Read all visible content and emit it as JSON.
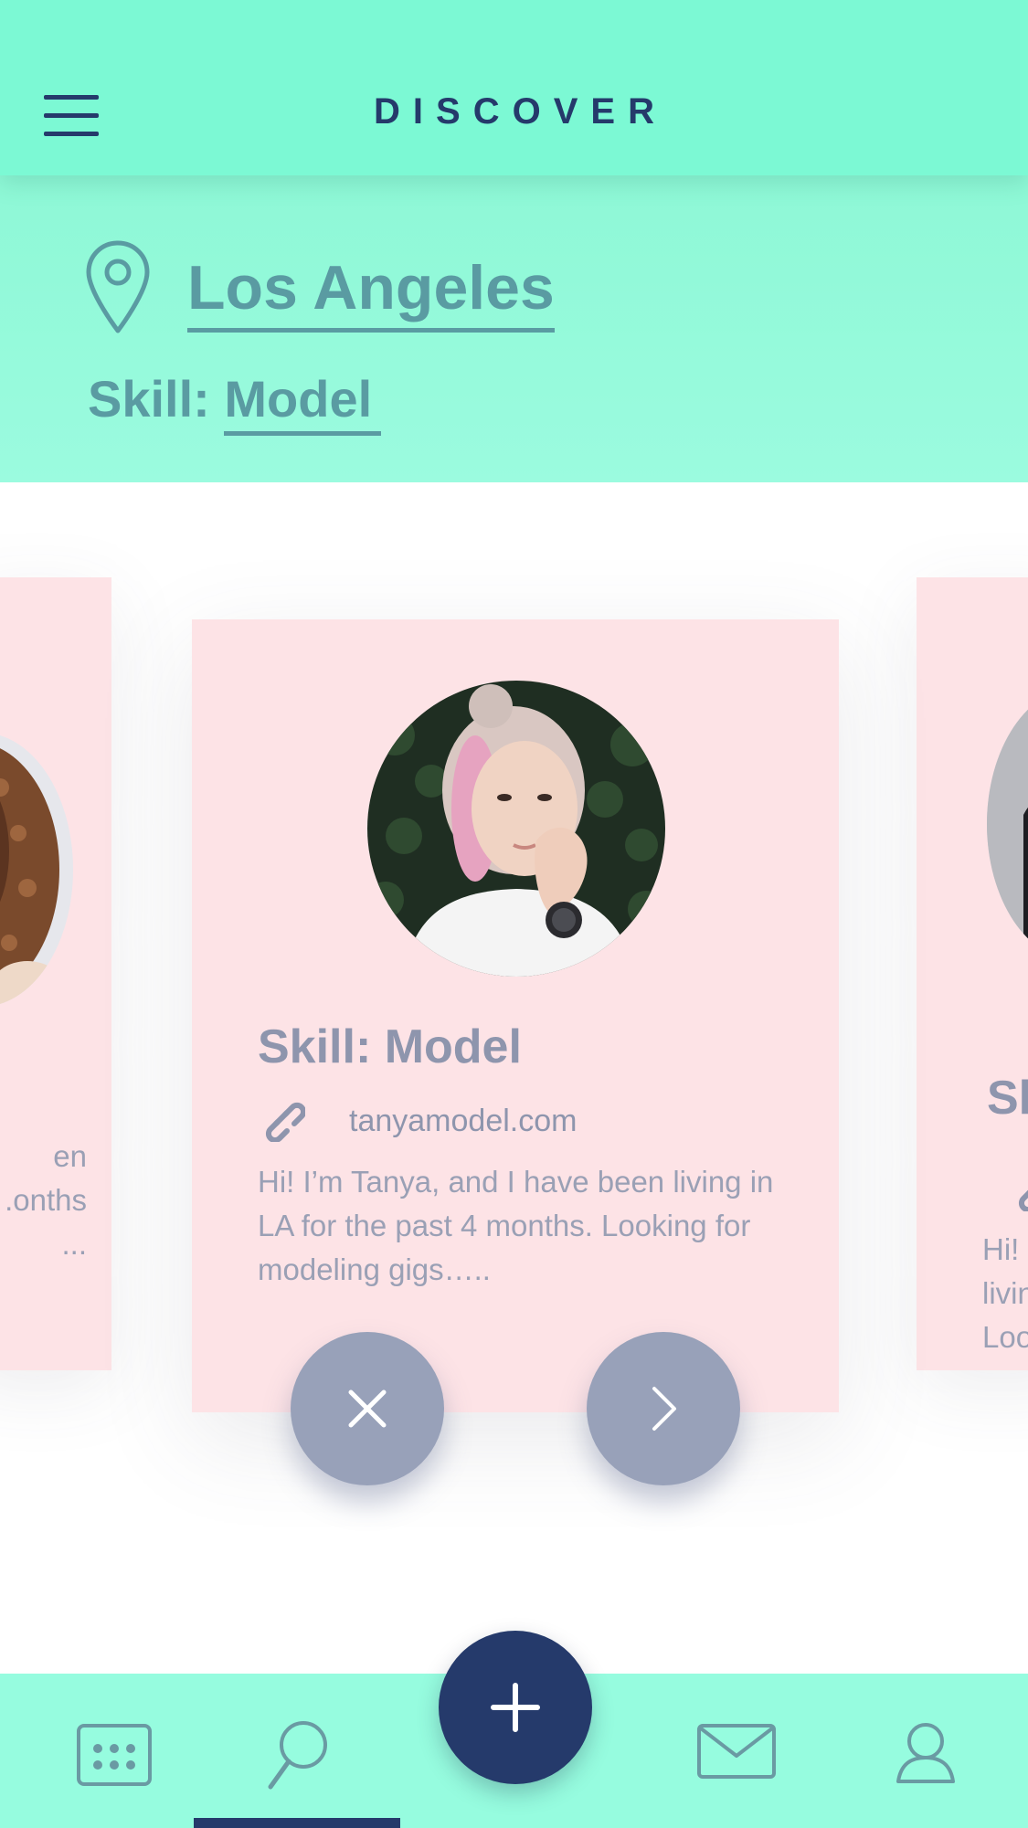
{
  "header": {
    "title": "DISCOVER",
    "menu_icon": "hamburger-menu-icon"
  },
  "filters": {
    "location_icon": "map-pin-icon",
    "city": "Los Angeles",
    "skill_label": "Skill:",
    "skill_value": "Model"
  },
  "cards": {
    "main": {
      "skill": "Skill: Model",
      "link_icon": "link-icon",
      "website": "tanyamodel.com",
      "bio": "Hi! I’m Tanya, and I have been living in LA for the past 4 months. Looking for modeling gigs…..",
      "reject_icon": "close-icon",
      "accept_icon": "chevron-right-icon"
    },
    "left": {
      "bio_lines": [
        "en",
        "onths.",
        "..."
      ]
    },
    "right": {
      "skill": "Sk",
      "bio_lines": [
        "Hi!",
        "livin",
        "Loo"
      ]
    }
  },
  "bottom_nav": {
    "items": [
      {
        "icon": "calendar-icon"
      },
      {
        "icon": "search-icon",
        "active": true
      },
      {
        "icon": "mail-icon"
      },
      {
        "icon": "profile-icon"
      }
    ],
    "fab_icon": "plus-icon"
  },
  "colors": {
    "header_bg": "#7cf9d4",
    "accent_navy": "#253a6b",
    "filter_text": "#5a9ba2",
    "card_bg": "#fde3e6",
    "button_gray": "#98a1b9"
  }
}
